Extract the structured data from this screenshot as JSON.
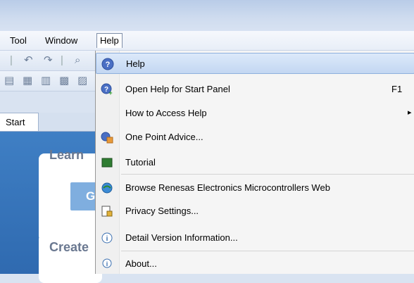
{
  "menubar": {
    "tool": "Tool",
    "window": "Window",
    "help": "Help"
  },
  "tab": {
    "start": "Start"
  },
  "start_panel": {
    "learn": "Learn",
    "create": "Create",
    "go_button": "G"
  },
  "help_menu": {
    "items": [
      {
        "label": "Help",
        "shortcut": "",
        "highlighted": true,
        "icon": "help-question-icon"
      },
      {
        "label": "Open Help for Start Panel",
        "shortcut": "F1",
        "icon": "help-open-icon"
      },
      {
        "label": "How to Access Help",
        "shortcut": "",
        "submenu": true,
        "icon": ""
      },
      {
        "label": "One Point Advice...",
        "shortcut": "",
        "icon": "advice-icon"
      },
      {
        "label": "Tutorial",
        "shortcut": "",
        "icon": "tutorial-icon"
      },
      {
        "label": "Browse Renesas Electronics Microcontrollers Web",
        "shortcut": "",
        "icon": "globe-icon"
      },
      {
        "label": "Privacy Settings...",
        "shortcut": "",
        "icon": "privacy-icon"
      },
      {
        "label": "Detail Version Information...",
        "shortcut": "",
        "icon": "version-info-icon"
      },
      {
        "label": "About...",
        "shortcut": "",
        "icon": "about-icon"
      }
    ],
    "submenu_arrow": "▸"
  },
  "colors": {
    "highlight": "#c3d7f2",
    "accent_blue": "#2f6ab0"
  }
}
